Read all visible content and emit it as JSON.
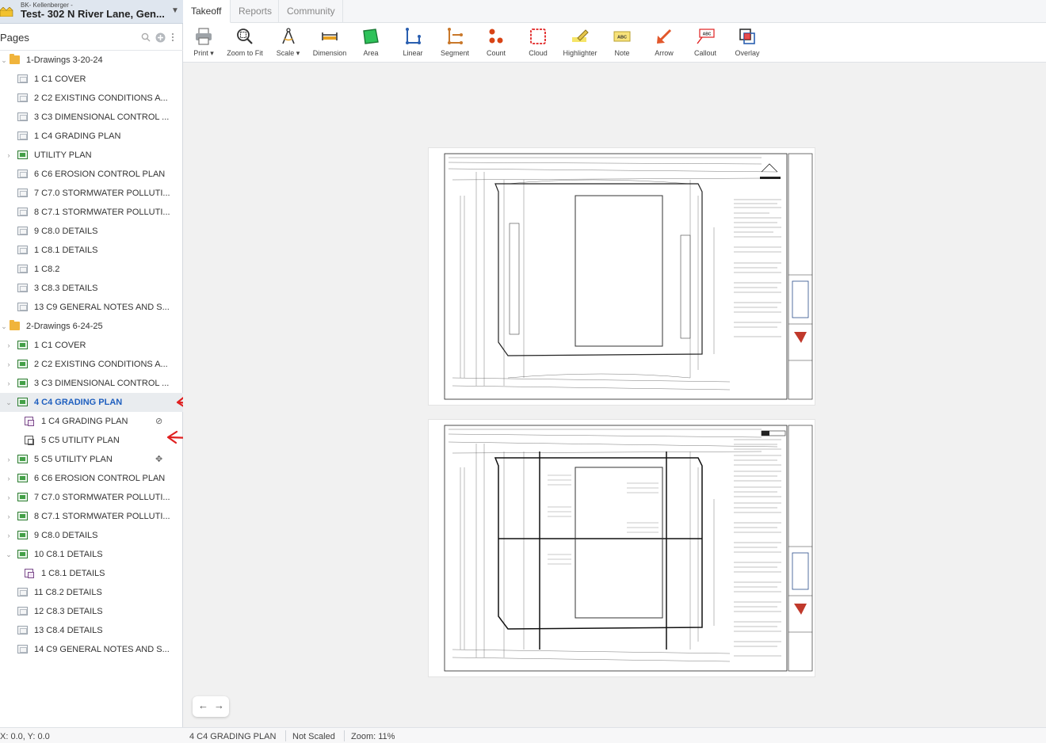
{
  "project": {
    "subtitle": "BK- Kellenberger -",
    "title": "Test- 302 N River Lane, Gen..."
  },
  "sidebar": {
    "title": "Pages",
    "icons": [
      "search-icon",
      "add-icon",
      "more-vertical-icon"
    ],
    "tree": [
      {
        "label": "1-Drawings 3-20-24",
        "type": "folder",
        "indent": 0,
        "expanded": true
      },
      {
        "label": "1 C1 COVER",
        "type": "page",
        "indent": 1
      },
      {
        "label": "2 C2 EXISTING CONDITIONS A...",
        "type": "page",
        "indent": 1
      },
      {
        "label": "3 C3 DIMENSIONAL CONTROL ...",
        "type": "page",
        "indent": 1
      },
      {
        "label": "1 C4 GRADING PLAN",
        "type": "page",
        "indent": 1
      },
      {
        "label": "UTILITY PLAN",
        "type": "gpage",
        "indent": 1,
        "collapsed": true
      },
      {
        "label": "6 C6 EROSION CONTROL PLAN",
        "type": "page",
        "indent": 1
      },
      {
        "label": "7 C7.0 STORMWATER POLLUTI...",
        "type": "page",
        "indent": 1
      },
      {
        "label": "8 C7.1 STORMWATER POLLUTI...",
        "type": "page",
        "indent": 1
      },
      {
        "label": "9 C8.0 DETAILS",
        "type": "page",
        "indent": 1
      },
      {
        "label": "1 C8.1 DETAILS",
        "type": "page",
        "indent": 1
      },
      {
        "label": "1 C8.2",
        "type": "page",
        "indent": 1
      },
      {
        "label": "3 C8.3 DETAILS",
        "type": "page",
        "indent": 1
      },
      {
        "label": "13 C9 GENERAL NOTES AND S...",
        "type": "page",
        "indent": 1
      },
      {
        "label": "2-Drawings 6-24-25",
        "type": "folder",
        "indent": 0,
        "expanded": true
      },
      {
        "label": "1 C1 COVER",
        "type": "gpage",
        "indent": 1,
        "collapsed": true
      },
      {
        "label": "2 C2 EXISTING CONDITIONS A...",
        "type": "gpage",
        "indent": 1,
        "collapsed": true
      },
      {
        "label": "3 C3 DIMENSIONAL CONTROL ...",
        "type": "gpage",
        "indent": 1,
        "collapsed": true
      },
      {
        "label": "4 C4 GRADING PLAN",
        "type": "gpage",
        "indent": 1,
        "expanded": true,
        "selected": true
      },
      {
        "label": "1 C4 GRADING PLAN",
        "type": "sub",
        "indent": 2,
        "icon": "eye-slash-icon"
      },
      {
        "label": "5 C5 UTILITY PLAN",
        "type": "sub2",
        "indent": 2
      },
      {
        "label": "5 C5 UTILITY PLAN",
        "type": "gpage",
        "indent": 1,
        "collapsed": true,
        "icon": "move-icon"
      },
      {
        "label": "6 C6 EROSION CONTROL PLAN",
        "type": "gpage",
        "indent": 1,
        "collapsed": true
      },
      {
        "label": "7 C7.0 STORMWATER POLLUTI...",
        "type": "gpage",
        "indent": 1,
        "collapsed": true
      },
      {
        "label": "8 C7.1 STORMWATER POLLUTI...",
        "type": "gpage",
        "indent": 1,
        "collapsed": true
      },
      {
        "label": "9 C8.0 DETAILS",
        "type": "gpage",
        "indent": 1,
        "collapsed": true
      },
      {
        "label": "10 C8.1 DETAILS",
        "type": "gpage",
        "indent": 1,
        "expanded": true
      },
      {
        "label": "1 C8.1 DETAILS",
        "type": "sub",
        "indent": 2
      },
      {
        "label": "11 C8.2 DETAILS",
        "type": "page",
        "indent": 1
      },
      {
        "label": "12 C8.3 DETAILS",
        "type": "page",
        "indent": 1
      },
      {
        "label": "13 C8.4 DETAILS",
        "type": "page",
        "indent": 1
      },
      {
        "label": "14 C9 GENERAL NOTES AND S...",
        "type": "page",
        "indent": 1
      }
    ]
  },
  "tabs": [
    {
      "label": "Takeoff",
      "active": true
    },
    {
      "label": "Reports",
      "active": false
    },
    {
      "label": "Community",
      "active": false
    }
  ],
  "toolbar": [
    {
      "label": "Print ▾",
      "icon": "printer-icon"
    },
    {
      "label": "Zoom to Fit",
      "icon": "zoom-icon"
    },
    {
      "label": "Scale ▾",
      "icon": "compass-icon"
    },
    {
      "label": "Dimension",
      "icon": "dimension-icon"
    },
    {
      "label": "Area",
      "icon": "area-icon"
    },
    {
      "label": "Linear",
      "icon": "linear-icon"
    },
    {
      "label": "Segment",
      "icon": "segment-icon"
    },
    {
      "label": "Count",
      "icon": "count-icon"
    },
    {
      "label": "Cloud",
      "icon": "cloud-icon"
    },
    {
      "label": "Highlighter",
      "icon": "highlighter-icon"
    },
    {
      "label": "Note",
      "icon": "note-icon"
    },
    {
      "label": "Arrow",
      "icon": "arrow-icon"
    },
    {
      "label": "Callout",
      "icon": "callout-icon"
    },
    {
      "label": "Overlay",
      "icon": "overlay-icon"
    }
  ],
  "icon_text": {
    "note": "ABC",
    "callout": "ABC"
  },
  "nav": {
    "back": "←",
    "forward": "→"
  },
  "status": {
    "coords": "X: 0.0, Y: 0.0",
    "page": "4 C4 GRADING PLAN",
    "scale": "Not Scaled",
    "zoom": "Zoom: 11%"
  },
  "colors": {
    "accent": "#1f5fbf",
    "annotation": "#e02020",
    "folder": "#f0b43c"
  }
}
